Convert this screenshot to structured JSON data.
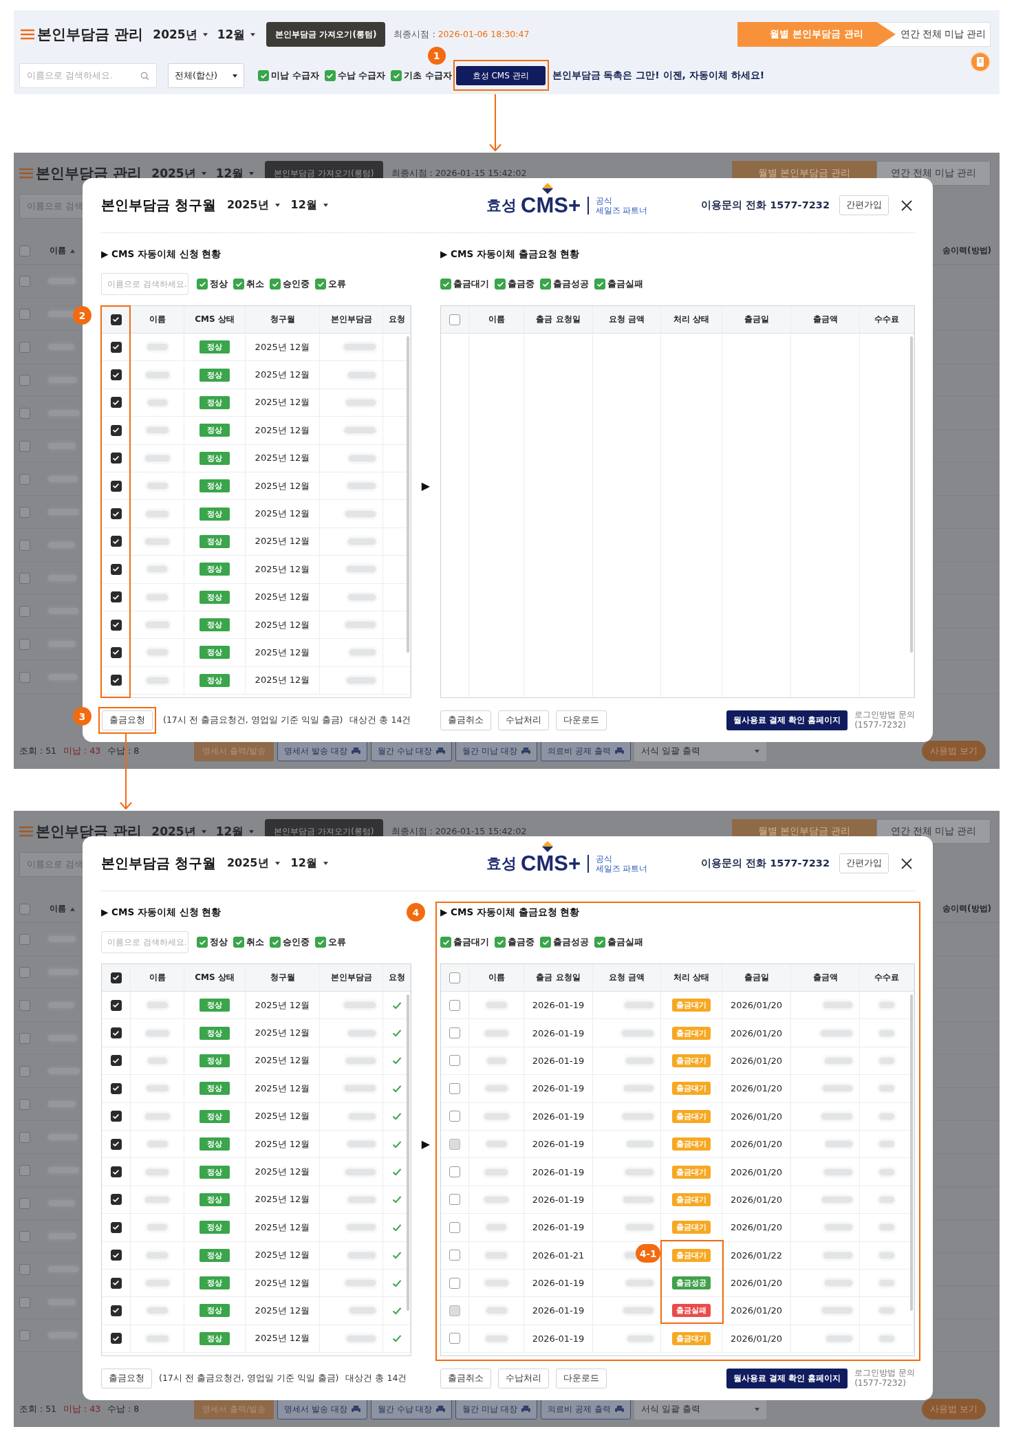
{
  "toolbar": {
    "title": "본인부담금 관리",
    "year": "2025년",
    "month": "12월",
    "import_button": "본인부담금 가져오기(롱텀)",
    "sync_label": "최종시점 :",
    "sync_time": "2026-01-06 18:30:47",
    "tabs": [
      {
        "label": "월별 본인부담금 관리",
        "selected": true
      },
      {
        "label": "연간 전체 미납 관리",
        "selected": false
      }
    ],
    "search": {
      "placeholder": "이름으로 검색하세요."
    },
    "scope_select": "전체(합산)",
    "filters": [
      {
        "label": "미납 수급자",
        "checked": true
      },
      {
        "label": "수납 수급자",
        "checked": true
      },
      {
        "label": "기초 수급자",
        "checked": true
      }
    ],
    "cms_button": "효성 CMS 관리",
    "step": "1",
    "promo": "본인부담금 독촉은 그만! 이젠, 자동이체 하세요!"
  },
  "screens": [
    {
      "page": {
        "title": "본인부담금 관리",
        "year": "2025년",
        "month": "12월",
        "import_button": "본인부담금 가져오기(롱텀)",
        "sync": "최종시점 : 2026-01-15 15:42:02",
        "tabs": [
          "월별 본인부담금 관리",
          "연간 전체 미납 관리"
        ],
        "search_placeholder": "이름으로 검색",
        "columns": [
          "이름",
          "송이력(방법)"
        ],
        "all_checked": false,
        "rows": [
          {
            "checked": false
          },
          {
            "checked": false
          },
          {
            "checked": false
          },
          {
            "checked": false
          },
          {
            "checked": false
          },
          {
            "checked": false
          },
          {
            "checked": false
          },
          {
            "checked": false
          },
          {
            "checked": false
          },
          {
            "checked": false
          },
          {
            "checked": false
          },
          {
            "checked": false
          },
          {
            "checked": false
          }
        ],
        "counts": [
          {
            "label": "조회 : ",
            "value": "51",
            "kind": "total"
          },
          {
            "label": "미납 : ",
            "value": "43",
            "kind": "unpaid"
          },
          {
            "label": "수납 : ",
            "value": "8",
            "kind": "paid"
          }
        ],
        "buttons": [
          {
            "label": "명세서 출력/발송",
            "kind": "primary"
          },
          {
            "label": "명세서 발송 대장",
            "kind": "print"
          },
          {
            "label": "월간 수납 대장",
            "kind": "print"
          },
          {
            "label": "월간 미납 대장",
            "kind": "print"
          },
          {
            "label": "의료비 공제 출력",
            "kind": "print"
          }
        ],
        "print_select": "서식 일괄 출력",
        "help_button": "사용법 보기"
      },
      "modal": {
        "title": "본인부담금 청구월",
        "year": "2025년",
        "month": "12월",
        "brand": {
          "name": "효성",
          "product": "CMS+",
          "tagline": [
            "공식",
            "세일즈 파트너"
          ]
        },
        "contact": "이용문의 전화 1577-7232",
        "signup_button": "간편가입",
        "left": {
          "heading": "▶ CMS 자동이체 신청 현황",
          "search": {
            "placeholder": "이름으로 검색하세요."
          },
          "filters": [
            {
              "label": "정상",
              "checked": true
            },
            {
              "label": "취소",
              "checked": true
            },
            {
              "label": "승인중",
              "checked": true
            },
            {
              "label": "오류",
              "checked": true
            }
          ],
          "columns": [
            "이름",
            "CMS 상태",
            "청구월",
            "본인부담금",
            "요청"
          ],
          "all_checked": true,
          "rows": [
            {
              "checked": true,
              "status": "정상",
              "month": "2025년 12월",
              "requested": false
            },
            {
              "checked": true,
              "status": "정상",
              "month": "2025년 12월",
              "requested": false
            },
            {
              "checked": true,
              "status": "정상",
              "month": "2025년 12월",
              "requested": false
            },
            {
              "checked": true,
              "status": "정상",
              "month": "2025년 12월",
              "requested": false
            },
            {
              "checked": true,
              "status": "정상",
              "month": "2025년 12월",
              "requested": false
            },
            {
              "checked": true,
              "status": "정상",
              "month": "2025년 12월",
              "requested": false
            },
            {
              "checked": true,
              "status": "정상",
              "month": "2025년 12월",
              "requested": false
            },
            {
              "checked": true,
              "status": "정상",
              "month": "2025년 12월",
              "requested": false
            },
            {
              "checked": true,
              "status": "정상",
              "month": "2025년 12월",
              "requested": false
            },
            {
              "checked": true,
              "status": "정상",
              "month": "2025년 12월",
              "requested": false
            },
            {
              "checked": true,
              "status": "정상",
              "month": "2025년 12월",
              "requested": false
            },
            {
              "checked": true,
              "status": "정상",
              "month": "2025년 12월",
              "requested": false
            },
            {
              "checked": true,
              "status": "정상",
              "month": "2025년 12월",
              "requested": false
            }
          ]
        },
        "transfer_arrow": "▶",
        "right": {
          "heading": "▶ CMS 자동이체 출금요청 현황",
          "filters": [
            {
              "label": "출금대기",
              "checked": true
            },
            {
              "label": "출금중",
              "checked": true
            },
            {
              "label": "출금성공",
              "checked": true
            },
            {
              "label": "출금실패",
              "checked": true
            }
          ],
          "columns": [
            "이름",
            "출금 요청일",
            "요청 금액",
            "처리 상태",
            "출금일",
            "출금액",
            "수수료"
          ],
          "all_checked": false
        },
        "footer": {
          "request_button": "출금요청",
          "note": "(17시 전 출금요청건, 영업일 기준 익일 출금)",
          "total": "대상건 총 14건",
          "actions": [
            "출금취소",
            "수납처리",
            "다운로드"
          ],
          "billing_button": "월사용료 결제 확인 홈페이지",
          "login_help": [
            "로그인방법 문의",
            "(1577-7232)"
          ]
        }
      },
      "annotations": [
        {
          "kind": "select-column",
          "label": "2"
        },
        {
          "kind": "request-button",
          "label": "3"
        }
      ]
    },
    {
      "page": {
        "title": "본인부담금 관리",
        "year": "2025년",
        "month": "12월",
        "import_button": "본인부담금 가져오기(롱텀)",
        "sync": "최종시점 : 2026-01-15 15:42:02",
        "tabs": [
          "월별 본인부담금 관리",
          "연간 전체 미납 관리"
        ],
        "search_placeholder": "이름으로 검색",
        "columns": [
          "이름",
          "송이력(방법)"
        ],
        "all_checked": false,
        "rows": [
          {
            "checked": false
          },
          {
            "checked": false
          },
          {
            "checked": false
          },
          {
            "checked": false
          },
          {
            "checked": false
          },
          {
            "checked": false
          },
          {
            "checked": false
          },
          {
            "checked": false
          },
          {
            "checked": false
          },
          {
            "checked": false
          },
          {
            "checked": false
          },
          {
            "checked": false
          },
          {
            "checked": false
          }
        ],
        "counts": [
          {
            "label": "조회 : ",
            "value": "51",
            "kind": "total"
          },
          {
            "label": "미납 : ",
            "value": "43",
            "kind": "unpaid"
          },
          {
            "label": "수납 : ",
            "value": "8",
            "kind": "paid"
          }
        ],
        "buttons": [
          {
            "label": "명세서 출력/발송",
            "kind": "primary"
          },
          {
            "label": "명세서 발송 대장",
            "kind": "print"
          },
          {
            "label": "월간 수납 대장",
            "kind": "print"
          },
          {
            "label": "월간 미납 대장",
            "kind": "print"
          },
          {
            "label": "의료비 공제 출력",
            "kind": "print"
          }
        ],
        "print_select": "서식 일괄 출력",
        "help_button": "사용법 보기"
      },
      "modal": {
        "title": "본인부담금 청구월",
        "year": "2025년",
        "month": "12월",
        "brand": {
          "name": "효성",
          "product": "CMS+",
          "tagline": [
            "공식",
            "세일즈 파트너"
          ]
        },
        "contact": "이용문의 전화 1577-7232",
        "signup_button": "간편가입",
        "left": {
          "heading": "▶ CMS 자동이체 신청 현황",
          "search": {
            "placeholder": "이름으로 검색하세요."
          },
          "filters": [
            {
              "label": "정상",
              "checked": true
            },
            {
              "label": "취소",
              "checked": true
            },
            {
              "label": "승인중",
              "checked": true
            },
            {
              "label": "오류",
              "checked": true
            }
          ],
          "columns": [
            "이름",
            "CMS 상태",
            "청구월",
            "본인부담금",
            "요청"
          ],
          "all_checked": true,
          "rows": [
            {
              "checked": true,
              "status": "정상",
              "month": "2025년 12월",
              "requested": true
            },
            {
              "checked": true,
              "status": "정상",
              "month": "2025년 12월",
              "requested": true
            },
            {
              "checked": true,
              "status": "정상",
              "month": "2025년 12월",
              "requested": true
            },
            {
              "checked": true,
              "status": "정상",
              "month": "2025년 12월",
              "requested": true
            },
            {
              "checked": true,
              "status": "정상",
              "month": "2025년 12월",
              "requested": true
            },
            {
              "checked": true,
              "status": "정상",
              "month": "2025년 12월",
              "requested": true
            },
            {
              "checked": true,
              "status": "정상",
              "month": "2025년 12월",
              "requested": true
            },
            {
              "checked": true,
              "status": "정상",
              "month": "2025년 12월",
              "requested": true
            },
            {
              "checked": true,
              "status": "정상",
              "month": "2025년 12월",
              "requested": true
            },
            {
              "checked": true,
              "status": "정상",
              "month": "2025년 12월",
              "requested": true
            },
            {
              "checked": true,
              "status": "정상",
              "month": "2025년 12월",
              "requested": true
            },
            {
              "checked": true,
              "status": "정상",
              "month": "2025년 12월",
              "requested": true
            },
            {
              "checked": true,
              "status": "정상",
              "month": "2025년 12월",
              "requested": true
            }
          ]
        },
        "transfer_arrow": "▶",
        "right": {
          "heading": "▶ CMS 자동이체 출금요청 현황",
          "filters": [
            {
              "label": "출금대기",
              "checked": true
            },
            {
              "label": "출금중",
              "checked": true
            },
            {
              "label": "출금성공",
              "checked": true
            },
            {
              "label": "출금실패",
              "checked": true
            }
          ],
          "columns": [
            "이름",
            "출금 요청일",
            "요청 금액",
            "처리 상태",
            "출금일",
            "출금액",
            "수수료"
          ],
          "all_checked": false,
          "rows": [
            {
              "checked": false,
              "disabled": false,
              "requested_on": "2026-01-19",
              "status": "출금대기",
              "color": "#f7a823",
              "paid_on": "2026/01/20"
            },
            {
              "checked": false,
              "disabled": false,
              "requested_on": "2026-01-19",
              "status": "출금대기",
              "color": "#f7a823",
              "paid_on": "2026/01/20"
            },
            {
              "checked": false,
              "disabled": false,
              "requested_on": "2026-01-19",
              "status": "출금대기",
              "color": "#f7a823",
              "paid_on": "2026/01/20"
            },
            {
              "checked": false,
              "disabled": false,
              "requested_on": "2026-01-19",
              "status": "출금대기",
              "color": "#f7a823",
              "paid_on": "2026/01/20"
            },
            {
              "checked": false,
              "disabled": false,
              "requested_on": "2026-01-19",
              "status": "출금대기",
              "color": "#f7a823",
              "paid_on": "2026/01/20"
            },
            {
              "checked": false,
              "disabled": true,
              "requested_on": "2026-01-19",
              "status": "출금대기",
              "color": "#f7a823",
              "paid_on": "2026/01/20"
            },
            {
              "checked": false,
              "disabled": false,
              "requested_on": "2026-01-19",
              "status": "출금대기",
              "color": "#f7a823",
              "paid_on": "2026/01/20"
            },
            {
              "checked": false,
              "disabled": false,
              "requested_on": "2026-01-19",
              "status": "출금대기",
              "color": "#f7a823",
              "paid_on": "2026/01/20"
            },
            {
              "checked": false,
              "disabled": false,
              "requested_on": "2026-01-19",
              "status": "출금대기",
              "color": "#f7a823",
              "paid_on": "2026/01/20"
            },
            {
              "checked": false,
              "disabled": false,
              "requested_on": "2026-01-21",
              "status": "출금대기",
              "color": "#f7a823",
              "paid_on": "2026/01/22"
            },
            {
              "checked": false,
              "disabled": false,
              "requested_on": "2026-01-19",
              "status": "출금성공",
              "color": "#3fa14a",
              "paid_on": "2026/01/20"
            },
            {
              "checked": false,
              "disabled": true,
              "requested_on": "2026-01-19",
              "status": "출금실패",
              "color": "#ea4b4b",
              "paid_on": "2026/01/20"
            },
            {
              "checked": false,
              "disabled": false,
              "requested_on": "2026-01-19",
              "status": "출금대기",
              "color": "#f7a823",
              "paid_on": "2026/01/20"
            }
          ]
        },
        "footer": {
          "request_button": "출금요청",
          "note": "(17시 전 출금요청건, 영업일 기준 익일 출금)",
          "total": "대상건 총 14건",
          "actions": [
            "출금취소",
            "수납처리",
            "다운로드"
          ],
          "billing_button": "월사용료 결제 확인 홈페이지",
          "login_help": [
            "로그인방법 문의",
            "(1577-7232)"
          ]
        }
      },
      "annotations": [
        {
          "kind": "right-panel",
          "label": "4"
        },
        {
          "kind": "status-cells",
          "label": "4-1"
        }
      ]
    }
  ]
}
